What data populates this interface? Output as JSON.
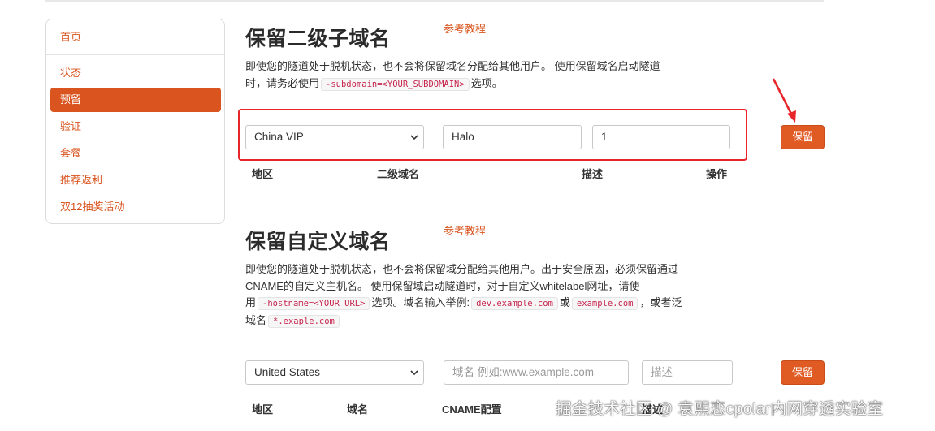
{
  "sidebar": {
    "items": [
      {
        "label": "首页"
      },
      {
        "label": "状态"
      },
      {
        "label": "预留",
        "active": true
      },
      {
        "label": "验证"
      },
      {
        "label": "套餐"
      },
      {
        "label": "推荐返利"
      },
      {
        "label": "双12抽奖活动"
      }
    ]
  },
  "reserve_subdomain": {
    "title": "保留二级子域名",
    "ref_link": "参考教程",
    "desc_line1": "即使您的隧道处于脱机状态，也不会将保留域名分配给其他用户。 使用保留域名启动隧道",
    "desc_line2_pre": "时，请务必使用",
    "desc_code": "-subdomain=<YOUR_SUBDOMAIN>",
    "desc_line2_post": "选项。",
    "region_select": "China VIP",
    "subdomain_value": "Halo",
    "description_value": "1",
    "save_button": "保留",
    "columns": [
      "地区",
      "二级域名",
      "描述",
      "操作"
    ]
  },
  "reserve_custom_domain": {
    "title": "保留自定义域名",
    "ref_link": "参考教程",
    "desc_line1": "即使您的隧道处于脱机状态，也不会将保留域分配给其他用户。出于安全原因，必须保留通过",
    "desc_line2": "CNAME的自定义主机名。 使用保留域启动隧道时，对于自定义whitelabel网址，请使",
    "desc_line3_pre": "用",
    "desc_code_hostname": "-hostname=<YOUR_URL>",
    "desc_line3_mid": "选项。域名输入举例:",
    "desc_code_example1": "dev.example.com",
    "desc_line3_or": "或",
    "desc_code_example2": "example.com",
    "desc_line3_post": "，或者泛",
    "desc_line4_pre": "域名",
    "desc_code_wildcard": "*.exaple.com",
    "region_select": "United States",
    "domain_placeholder": "域名 例如:www.example.com",
    "description_placeholder": "描述",
    "save_button": "保留",
    "columns": [
      "地区",
      "域名",
      "CNAME配置",
      "描述"
    ]
  },
  "watermark": "掘金技术社区 @ 袁熙恋cpolar内网穿透实验室",
  "colors": {
    "accent": "#d9541e",
    "button": "#e05a24",
    "highlight_box": "#e8262a",
    "code_text": "#c7254e"
  }
}
